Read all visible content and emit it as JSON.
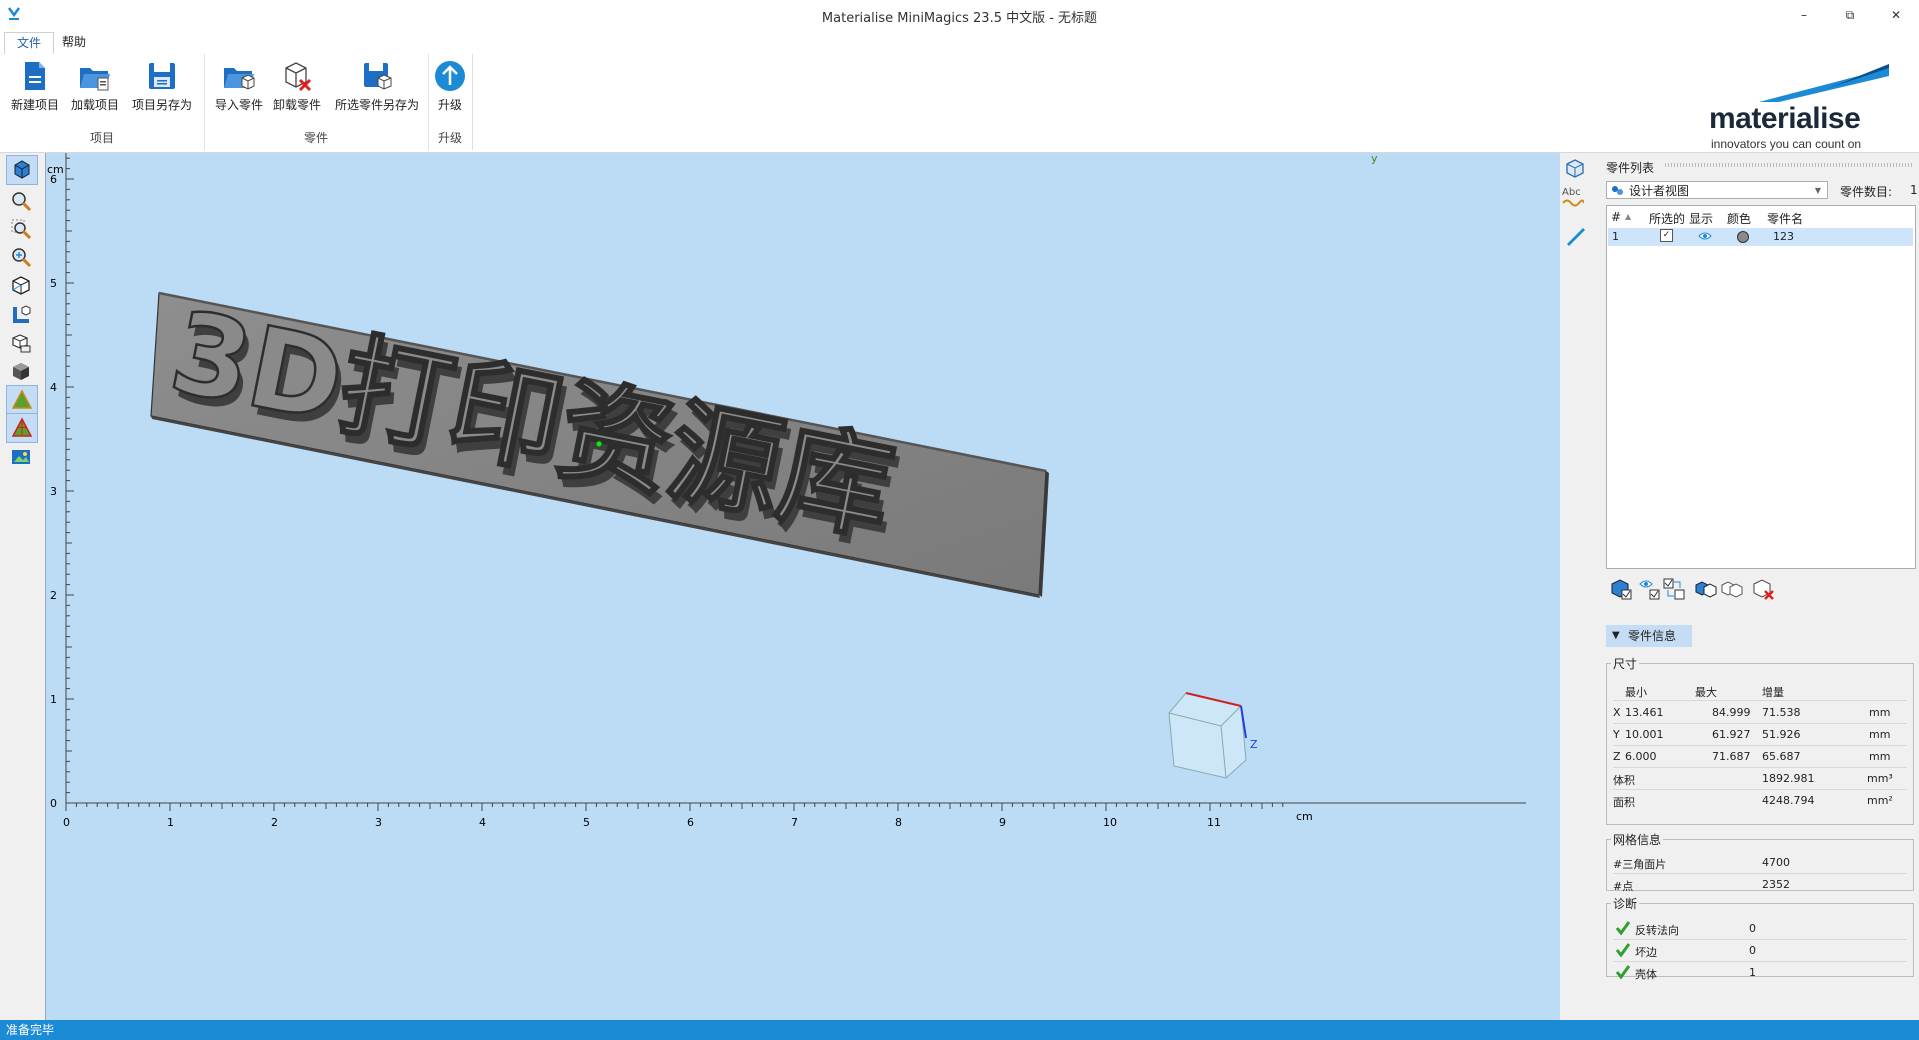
{
  "window": {
    "title": "Materialise MiniMagics 23.5 中文版 - 无标题",
    "minimize": "–",
    "restore": "⧉",
    "close": "✕"
  },
  "menu": {
    "tabs": [
      "文件",
      "帮助"
    ]
  },
  "ribbon": {
    "groups": [
      {
        "label": "项目",
        "buttons": [
          "新建项目",
          "加载项目",
          "项目另存为"
        ]
      },
      {
        "label": "零件",
        "buttons": [
          "导入零件",
          "卸载零件",
          "所选零件另存为"
        ]
      },
      {
        "label": "升级",
        "buttons": [
          "升级"
        ]
      }
    ]
  },
  "logo": {
    "word": "materialise",
    "tagline": "innovators you can count on"
  },
  "viewport": {
    "y_unit": "cm",
    "x_unit": "cm",
    "y_ticks": [
      "6",
      "5",
      "4",
      "3",
      "2",
      "1",
      "0"
    ],
    "x_ticks": [
      "0",
      "1",
      "2",
      "3",
      "4",
      "5",
      "6",
      "7",
      "8",
      "9",
      "10",
      "11"
    ],
    "model_text": "3D打印资源库",
    "axis_y_label": "y",
    "axis_z_label": "Z"
  },
  "right_tools": {
    "abc_label": "Abc"
  },
  "part_list": {
    "title": "零件列表",
    "view_select": "设计者视图",
    "count_label": "零件数目:",
    "count_value": "1",
    "columns": [
      "#",
      "所选的",
      "显示",
      "颜色",
      "零件名"
    ],
    "rows": [
      {
        "index": "1",
        "name": "123"
      }
    ]
  },
  "part_info": {
    "title": "零件信息",
    "dimensions": {
      "legend": "尺寸",
      "headers": [
        "最小",
        "最大",
        "增量"
      ],
      "rows": [
        {
          "axis": "X",
          "min": "13.461",
          "max": "84.999",
          "delta": "71.538",
          "unit": "mm"
        },
        {
          "axis": "Y",
          "min": "10.001",
          "max": "61.927",
          "delta": "51.926",
          "unit": "mm"
        },
        {
          "axis": "Z",
          "min": "6.000",
          "max": "71.687",
          "delta": "65.687",
          "unit": "mm"
        }
      ],
      "volume_label": "体积",
      "volume": "1892.981",
      "volume_unit": "mm³",
      "area_label": "面积",
      "area": "4248.794",
      "area_unit": "mm²"
    },
    "mesh": {
      "legend": "网格信息",
      "triangles_label": "#三角面片",
      "triangles": "4700",
      "points_label": "#点",
      "points": "2352"
    },
    "diagnostics": {
      "legend": "诊断",
      "rows": [
        {
          "label": "反转法向",
          "value": "0"
        },
        {
          "label": "坏边",
          "value": "0"
        },
        {
          "label": "壳体",
          "value": "1"
        }
      ]
    }
  },
  "status": {
    "text": "准备完毕"
  }
}
